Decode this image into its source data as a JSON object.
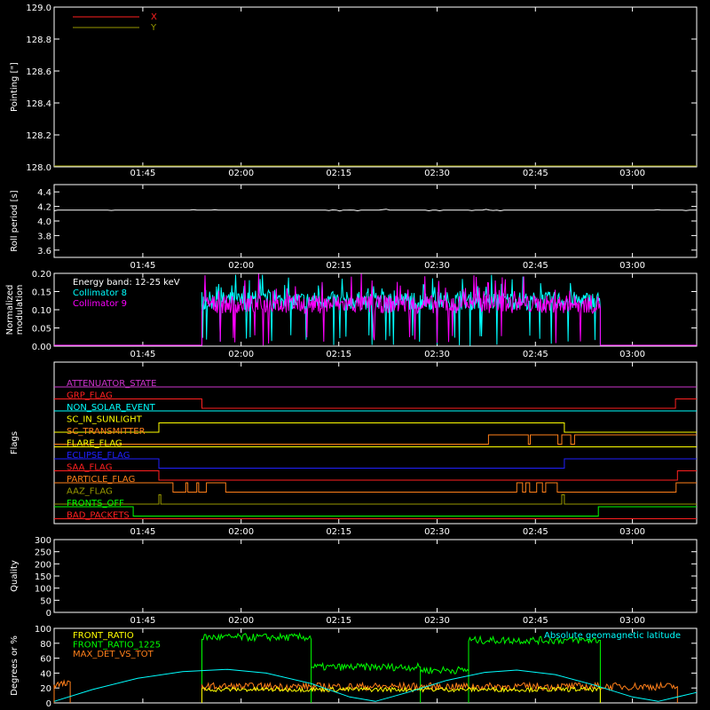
{
  "x_ticks": [
    "01:45",
    "02:00",
    "02:15",
    "02:30",
    "02:45",
    "03:00"
  ],
  "colors": {
    "background": "#000000",
    "axis": "#ffffff",
    "red": "#ff2020",
    "orange": "#ff7f1a",
    "yellow": "#ffff00",
    "green": "#00ff00",
    "cyan": "#00ffff",
    "magenta": "#ff00ff",
    "blue": "#2020ff",
    "olive": "#999900",
    "purple": "#cc33cc"
  },
  "chart_data": [
    {
      "id": "pointing",
      "type": "line",
      "ylabel": "Pointing [\"]",
      "ylim": [
        128.0,
        129.0
      ],
      "yticks": [
        "129.0",
        "128.8",
        "128.6",
        "128.4",
        "128.2",
        "128.0"
      ],
      "legend": [
        {
          "name": "X",
          "color": "#ff2020"
        },
        {
          "name": "Y",
          "color": "#999900"
        }
      ],
      "series": [
        {
          "name": "X",
          "color": "#ff2020",
          "points": []
        },
        {
          "name": "Y",
          "color": "#999900",
          "points": [
            [
              0,
              128.0
            ],
            [
              1,
              128.0
            ]
          ]
        }
      ]
    },
    {
      "id": "roll",
      "type": "line",
      "ylabel": "Roll period [s]",
      "ylim": [
        3.5,
        4.5
      ],
      "yticks": [
        "4.4",
        "4.2",
        "4.0",
        "3.8",
        "3.6"
      ],
      "series": [
        {
          "name": "roll",
          "color": "#ffffff",
          "points": [
            [
              0,
              4.15
            ],
            [
              1,
              4.15
            ]
          ]
        }
      ]
    },
    {
      "id": "modulation",
      "type": "line",
      "ylabel": "Normalized\nmodulation",
      "ylim": [
        0.0,
        0.2
      ],
      "yticks": [
        "0.20",
        "0.15",
        "0.10",
        "0.05",
        "0.00"
      ],
      "legend_title": "Energy band: 12-25 keV",
      "legend": [
        {
          "name": "Collimator 8",
          "color": "#00ffff"
        },
        {
          "name": "Collimator 9",
          "color": "#ff00ff"
        }
      ],
      "active_range": [
        0.23,
        0.85
      ],
      "series": [
        {
          "name": "Collimator 8",
          "color": "#00ffff",
          "mean": 0.11
        },
        {
          "name": "Collimator 9",
          "color": "#ff00ff",
          "mean": 0.1
        }
      ]
    },
    {
      "id": "flags",
      "type": "line",
      "ylabel": "Flags",
      "flags": [
        {
          "name": "ATTENUATOR_STATE",
          "color": "#cc33cc",
          "steps": []
        },
        {
          "name": "GRP_FLAG",
          "color": "#ff2020",
          "steps": [
            [
              0,
              1
            ],
            [
              0.23,
              0
            ],
            [
              0.967,
              1
            ]
          ]
        },
        {
          "name": "NON_SOLAR_EVENT",
          "color": "#00ffff",
          "steps": []
        },
        {
          "name": "SC_IN_SUNLIGHT",
          "color": "#ffff00",
          "steps": [
            [
              0,
              0
            ],
            [
              0.163,
              1
            ],
            [
              0.794,
              0
            ]
          ]
        },
        {
          "name": "SC_TRANSMITTER",
          "color": "#ff7f1a",
          "steps": [
            [
              0,
              0
            ],
            [
              0.676,
              1
            ],
            [
              0.738,
              0
            ],
            [
              0.741,
              1
            ],
            [
              0.784,
              0
            ],
            [
              0.79,
              1
            ],
            [
              0.804,
              0
            ],
            [
              0.81,
              1
            ],
            [
              1,
              1
            ]
          ]
        },
        {
          "name": "FLARE_FLAG",
          "color": "#ffff00",
          "steps": []
        },
        {
          "name": "ECLIPSE_FLAG",
          "color": "#2020ff",
          "steps": [
            [
              0,
              1
            ],
            [
              0.163,
              0
            ],
            [
              0.794,
              1
            ]
          ]
        },
        {
          "name": "SAA_FLAG",
          "color": "#ff2020",
          "steps": [
            [
              0,
              1
            ],
            [
              0.163,
              0
            ],
            [
              0.97,
              1
            ]
          ]
        },
        {
          "name": "PARTICLE_FLAG",
          "color": "#ff7f1a",
          "steps": [
            [
              0,
              1
            ],
            [
              0.185,
              0
            ],
            [
              0.205,
              1
            ],
            [
              0.208,
              0
            ],
            [
              0.222,
              1
            ],
            [
              0.225,
              0
            ],
            [
              0.237,
              1
            ],
            [
              0.267,
              0
            ],
            [
              0.72,
              1
            ],
            [
              0.729,
              0
            ],
            [
              0.734,
              1
            ],
            [
              0.74,
              0
            ],
            [
              0.751,
              1
            ],
            [
              0.76,
              0
            ],
            [
              0.765,
              1
            ],
            [
              0.783,
              0
            ],
            [
              0.968,
              1
            ]
          ]
        },
        {
          "name": "AAZ_FLAG",
          "color": "#999900",
          "steps": [
            [
              0,
              0
            ],
            [
              0.163,
              1
            ],
            [
              0.166,
              0
            ],
            [
              0.79,
              1
            ],
            [
              0.794,
              0
            ]
          ]
        },
        {
          "name": "FRONTS_OFF",
          "color": "#00ff00",
          "steps": [
            [
              0,
              1
            ],
            [
              0.123,
              0
            ],
            [
              0.847,
              1
            ]
          ]
        },
        {
          "name": "BAD_PACKETS",
          "color": "#ff2020",
          "steps": []
        }
      ]
    },
    {
      "id": "quality",
      "type": "line",
      "ylabel": "Quality",
      "ylim": [
        0,
        300
      ],
      "yticks": [
        "300",
        "250",
        "200",
        "150",
        "100",
        "50",
        "0"
      ],
      "series": []
    },
    {
      "id": "ratios",
      "type": "line",
      "ylabel": "Degrees or %",
      "ylim": [
        0,
        100
      ],
      "yticks": [
        "100",
        "80",
        "60",
        "40",
        "20",
        "0"
      ],
      "legend": [
        {
          "name": "FRONT_RATIO",
          "color": "#ffff00"
        },
        {
          "name": "FRONT_RATIO_1225",
          "color": "#00ff00"
        },
        {
          "name": "MAX_DET_VS_TOT",
          "color": "#ff7f1a"
        }
      ],
      "legend_right": {
        "name": "Absolute geomagnetic latitude",
        "color": "#00ffff"
      },
      "series": [
        {
          "name": "FRONT_RATIO_1225",
          "color": "#00ff00",
          "segments": [
            [
              0.23,
              0.4,
              88
            ],
            [
              0.4,
              0.57,
              48
            ],
            [
              0.57,
              0.645,
              44
            ],
            [
              0.645,
              0.85,
              84
            ]
          ]
        },
        {
          "name": "MAX_DET_VS_TOT",
          "color": "#ff7f1a",
          "segments": [
            [
              0.0,
              0.025,
              25
            ],
            [
              0.23,
              0.97,
              22
            ]
          ]
        },
        {
          "name": "FRONT_RATIO",
          "color": "#ffff00",
          "segments": [
            [
              0.23,
              0.85,
              18
            ]
          ]
        },
        {
          "name": "Absolute geomagnetic latitude",
          "color": "#00ffff",
          "curve": [
            [
              0,
              2
            ],
            [
              0.06,
              18
            ],
            [
              0.13,
              33
            ],
            [
              0.2,
              42
            ],
            [
              0.27,
              45
            ],
            [
              0.33,
              40
            ],
            [
              0.4,
              26
            ],
            [
              0.46,
              8
            ],
            [
              0.5,
              2
            ],
            [
              0.55,
              14
            ],
            [
              0.61,
              30
            ],
            [
              0.67,
              41
            ],
            [
              0.72,
              44
            ],
            [
              0.78,
              38
            ],
            [
              0.84,
              24
            ],
            [
              0.9,
              8
            ],
            [
              0.94,
              2
            ],
            [
              1.0,
              14
            ]
          ]
        }
      ]
    }
  ]
}
